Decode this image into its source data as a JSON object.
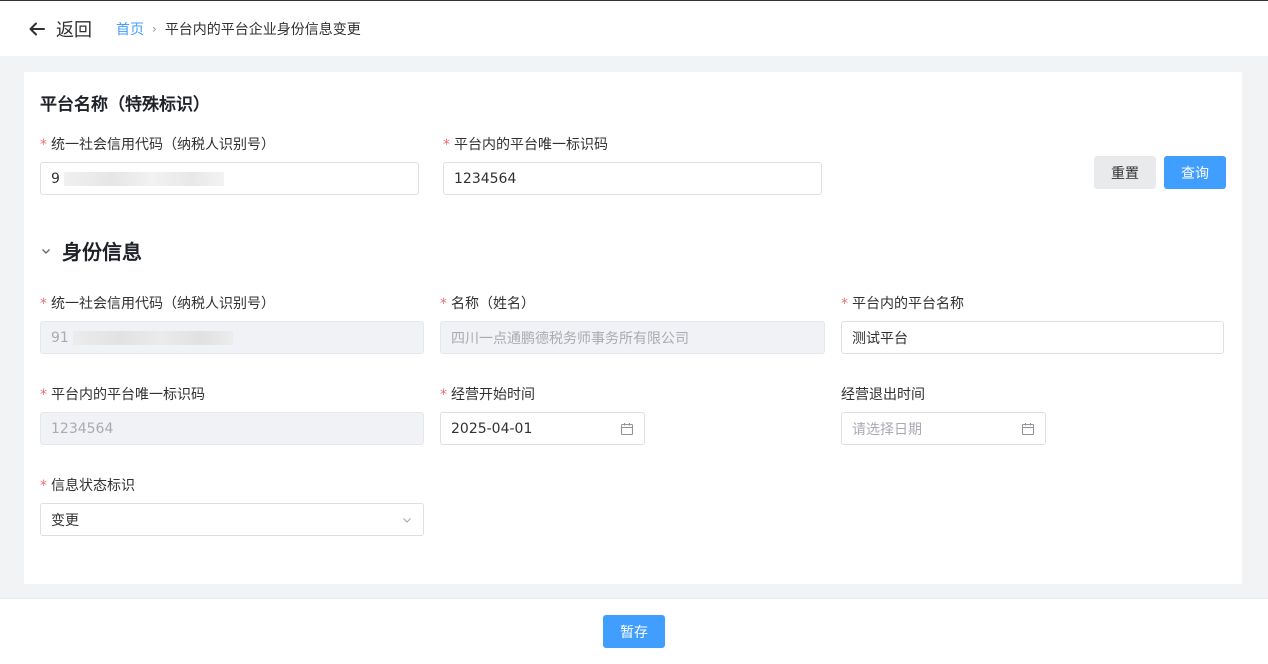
{
  "header": {
    "back_label": "返回",
    "breadcrumb": {
      "home": "首页",
      "separator": "›",
      "current": "平台内的平台企业身份信息变更"
    }
  },
  "query": {
    "title": "平台名称（特殊标识）",
    "credit_code": {
      "label": "统一社会信用代码（纳税人识别号）",
      "value": "9"
    },
    "platform_id": {
      "label": "平台内的平台唯一标识码",
      "value": "1234564"
    },
    "reset_label": "重置",
    "query_label": "查询"
  },
  "identity": {
    "title": "身份信息",
    "credit_code": {
      "label": "统一社会信用代码（纳税人识别号）",
      "value": "91"
    },
    "name": {
      "label": "名称（姓名）",
      "value": "四川一点通鹏德税务师事务所有限公司"
    },
    "platform_name": {
      "label": "平台内的平台名称",
      "value": "测试平台"
    },
    "platform_id": {
      "label": "平台内的平台唯一标识码",
      "value": "1234564"
    },
    "start_date": {
      "label": "经营开始时间",
      "value": "2025-04-01"
    },
    "exit_date": {
      "label": "经营退出时间",
      "placeholder": "请选择日期"
    },
    "status": {
      "label": "信息状态标识",
      "value": "变更"
    }
  },
  "required_mark": "*",
  "footer": {
    "save_label": "暂存"
  },
  "colors": {
    "primary": "#409eff",
    "required": "#f56c6c",
    "disabled_bg": "#f0f2f5"
  }
}
